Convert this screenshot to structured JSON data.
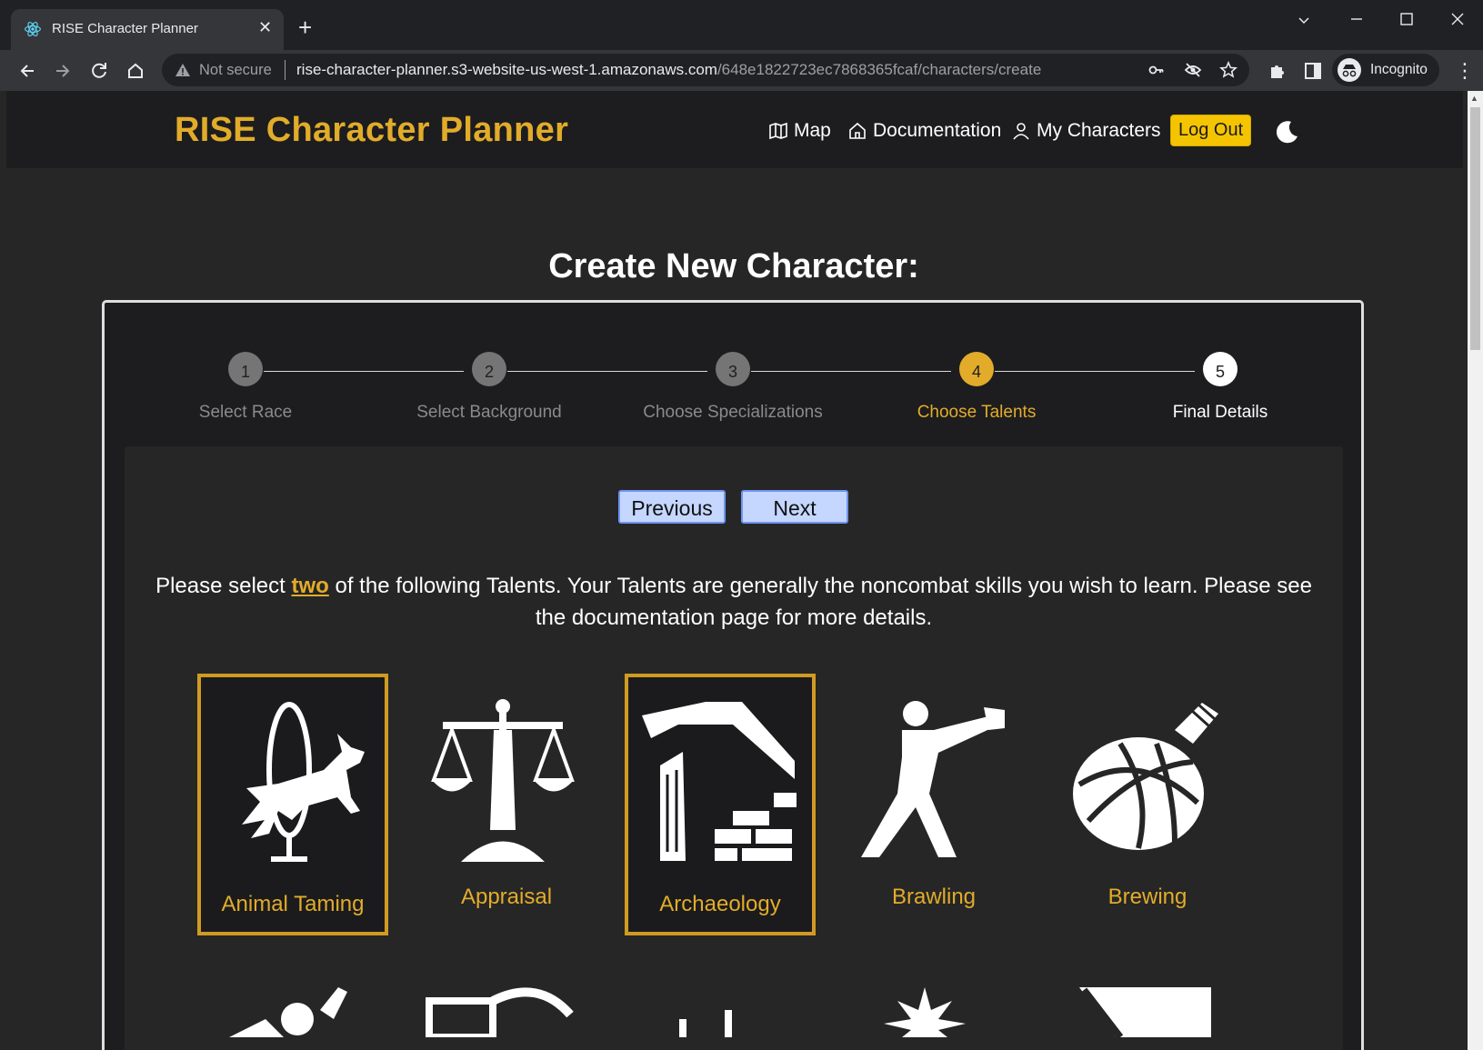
{
  "browser": {
    "tab_title": "RISE Character Planner",
    "tab_close": "✕",
    "new_tab": "+",
    "security_label": "Not secure",
    "url_host": "rise-character-planner.s3-website-us-west-1.amazonaws.com",
    "url_path": "/648e1822723ec7868365fcaf/characters/create",
    "profile_label": "Incognito",
    "icons": [
      "react-icon",
      "back-icon",
      "forward-icon",
      "reload-icon",
      "home-icon",
      "warning-icon",
      "key-icon",
      "eye-off-icon",
      "star-icon",
      "puzzle-icon",
      "sidepanel-icon",
      "incognito-icon",
      "menu-icon"
    ]
  },
  "nav": {
    "brand": "RISE Character Planner",
    "links": [
      {
        "label": "Map",
        "icon": "map-icon"
      },
      {
        "label": "Documentation",
        "icon": "home-icon"
      },
      {
        "label": "My Characters",
        "icon": "user-icon"
      }
    ],
    "logout": "Log Out",
    "theme_icon": "moon-icon"
  },
  "page_title": "Create New Character:",
  "steps": [
    {
      "number": "1",
      "label": "Select Race",
      "state": "done"
    },
    {
      "number": "2",
      "label": "Select Background",
      "state": "done"
    },
    {
      "number": "3",
      "label": "Choose Specializations",
      "state": "done"
    },
    {
      "number": "4",
      "label": "Choose Talents",
      "state": "active"
    },
    {
      "number": "5",
      "label": "Final Details",
      "state": "pending"
    }
  ],
  "buttons": {
    "previous": "Previous",
    "next": "Next"
  },
  "instructions": {
    "before": "Please select ",
    "highlight": "two",
    "after": " of the following Talents. Your Talents are generally the noncombat skills you wish to learn. Please see the documentation page for more details."
  },
  "talents": [
    {
      "label": "Animal Taming",
      "icon": "animal-taming-icon",
      "selected": true
    },
    {
      "label": "Appraisal",
      "icon": "appraisal-icon",
      "selected": false
    },
    {
      "label": "Archaeology",
      "icon": "archaeology-icon",
      "selected": true
    },
    {
      "label": "Brawling",
      "icon": "brawling-icon",
      "selected": false
    },
    {
      "label": "Brewing",
      "icon": "brewing-icon",
      "selected": false
    }
  ],
  "colors": {
    "accent": "#e2ac2a",
    "button_bg": "#c5d6ff",
    "logout_bg": "#f5c400"
  }
}
